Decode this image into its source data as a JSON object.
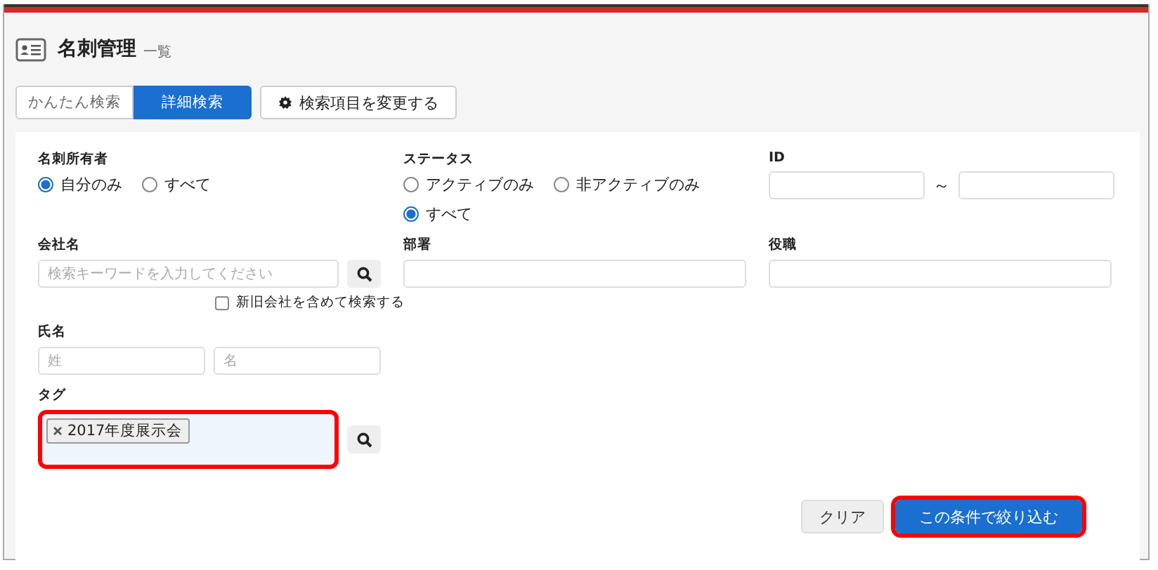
{
  "header": {
    "title": "名刺管理",
    "subtitle": "一覧"
  },
  "tabs": [
    {
      "label": "かんたん検索",
      "selected": false
    },
    {
      "label": "詳細検索",
      "selected": true
    }
  ],
  "settings_button": {
    "label": "検索項目を変更する"
  },
  "form": {
    "owner": {
      "label": "名刺所有者",
      "options": [
        {
          "label": "自分のみ",
          "selected": true
        },
        {
          "label": "すべて",
          "selected": false
        }
      ]
    },
    "status": {
      "label": "ステータス",
      "options": [
        {
          "label": "アクティブのみ",
          "selected": false
        },
        {
          "label": "非アクティブのみ",
          "selected": false
        },
        {
          "label": "すべて",
          "selected": true
        }
      ]
    },
    "id": {
      "label": "ID",
      "separator": "～"
    },
    "company": {
      "label": "会社名",
      "placeholder": "検索キーワードを入力してください",
      "include_old": {
        "label": "新旧会社を含めて検索する",
        "checked": false
      }
    },
    "department": {
      "label": "部署"
    },
    "position": {
      "label": "役職"
    },
    "name": {
      "label": "氏名",
      "last_placeholder": "姓",
      "first_placeholder": "名"
    },
    "tag": {
      "label": "タグ",
      "tags": [
        "2017年度展示会"
      ],
      "highlighted": true
    }
  },
  "buttons": [
    {
      "label": "クリア",
      "kind": "secondary",
      "highlighted": false
    },
    {
      "label": "この条件で絞り込む",
      "kind": "primary",
      "highlighted": true
    }
  ]
}
